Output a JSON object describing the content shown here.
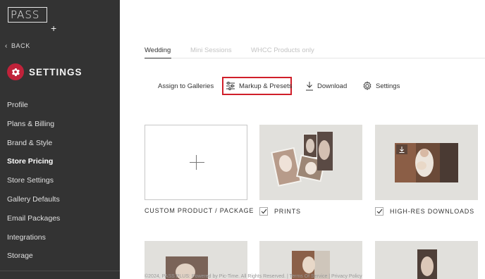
{
  "sidebar": {
    "logo": "PASS",
    "logo_plus": "+",
    "back": "BACK",
    "title": "SETTINGS",
    "items": [
      {
        "label": "Profile"
      },
      {
        "label": "Plans & Billing"
      },
      {
        "label": "Brand & Style"
      },
      {
        "label": "Store Pricing",
        "active": true
      },
      {
        "label": "Store Settings"
      },
      {
        "label": "Gallery Defaults"
      },
      {
        "label": "Email Packages"
      },
      {
        "label": "Integrations"
      },
      {
        "label": "Storage"
      }
    ]
  },
  "tabs": [
    {
      "label": "Wedding",
      "active": true
    },
    {
      "label": "Mini Sessions"
    },
    {
      "label": "WHCC Products only"
    }
  ],
  "toolbar": {
    "assign": "Assign to Galleries",
    "markup": "Markup & Presets",
    "download": "Download",
    "settings": "Settings"
  },
  "cards": [
    {
      "label": "CUSTOM PRODUCT / PACKAGE"
    },
    {
      "label": "PRINTS",
      "checked": true
    },
    {
      "label": "HIGH-RES DOWNLOADS",
      "checked": true
    }
  ],
  "footer": "©2024, PASS PLUS: Powered by Pic-Time. All Rights Reserved. | Terms Of Service | Privacy Policy",
  "colors": {
    "sidebar_bg": "#333333",
    "accent": "#c0223a",
    "highlight": "#d01f2a"
  }
}
